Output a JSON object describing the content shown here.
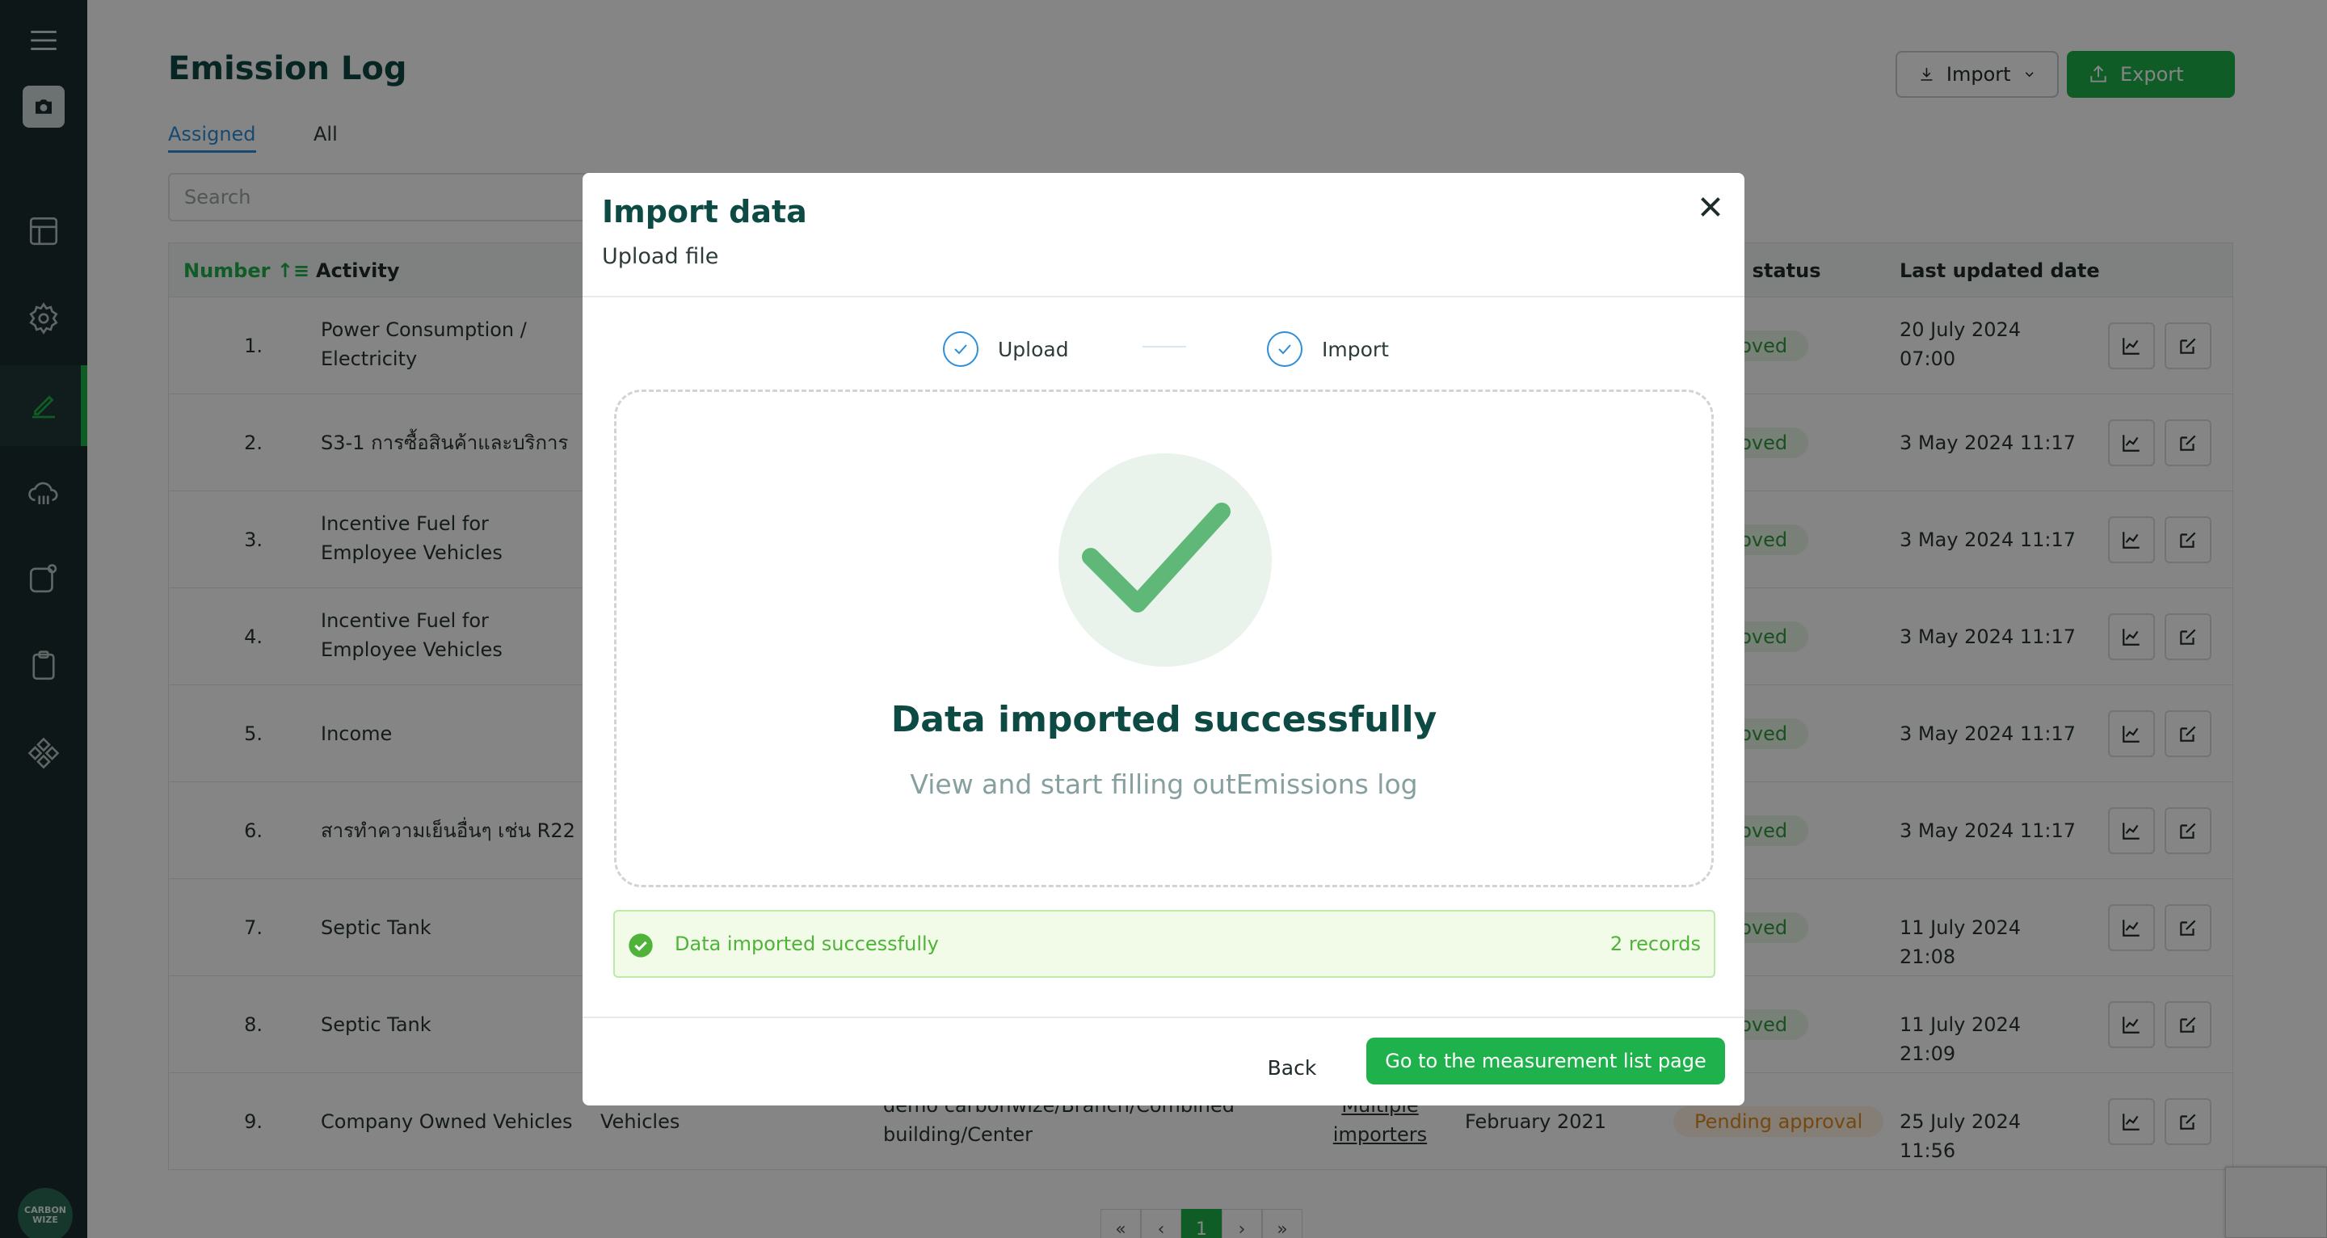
{
  "page": {
    "title": "Emission Log",
    "tabs": [
      "Assigned",
      "All"
    ],
    "search_placeholder": "Search",
    "import_label": "Import",
    "export_label": "Export"
  },
  "table": {
    "headers": {
      "number": "Number",
      "activity": "Activity",
      "approval_status": "Approval status",
      "last_updated": "Last updated date"
    },
    "rows": [
      {
        "num": "1.",
        "activity": "Power Consumption / Electricity",
        "status": "Approved",
        "date": "20 July 2024 07:00"
      },
      {
        "num": "2.",
        "activity": "S3-1 การซื้อสินค้าและบริการ",
        "status": "Approved",
        "date": "3 May 2024 11:17"
      },
      {
        "num": "3.",
        "activity": "Incentive Fuel for Employee Vehicles",
        "status": "Approved",
        "date": "3 May 2024 11:17"
      },
      {
        "num": "4.",
        "activity": "Incentive Fuel for Employee Vehicles",
        "status": "Approved",
        "date": "3 May 2024 11:17"
      },
      {
        "num": "5.",
        "activity": "Income",
        "status": "Approved",
        "date": "3 May 2024 11:17"
      },
      {
        "num": "6.",
        "activity": "สารทำความเย็นอื่นๆ เช่น R22",
        "status": "Approved",
        "date": "3 May 2024 11:17"
      },
      {
        "num": "7.",
        "activity": "Septic Tank",
        "status": "Approved",
        "date": "11 July 2024 21:08"
      },
      {
        "num": "8.",
        "activity": "Septic Tank",
        "status": "Approved",
        "date": "11 July 2024 21:09"
      },
      {
        "num": "9.",
        "activity": "Company Owned Vehicles",
        "type": "Vehicles",
        "location": "demo carbonwize/Branch/Combined building/Center",
        "importer": "Multiple importers",
        "period": "February 2021",
        "status": "Pending approval",
        "date": "25 July 2024 11:56"
      }
    ]
  },
  "pagination": {
    "first": "«",
    "prev": "‹",
    "current": "1",
    "next": "›",
    "last": "»"
  },
  "sidebar": {
    "logo_text": "CARBON WIZE"
  },
  "modal": {
    "title": "Import data",
    "subtitle": "Upload file",
    "steps": [
      "Upload",
      "Import"
    ],
    "success_title": "Data imported successfully",
    "success_desc": "View and start filling outEmissions log",
    "alert_text": "Data imported successfully",
    "alert_count": "2 records",
    "back_label": "Back",
    "go_label": "Go to the measurement list page"
  },
  "colors": {
    "brand_green": "#1fb14b",
    "title_teal": "#0e4a44",
    "link_blue": "#2e8fd8"
  }
}
